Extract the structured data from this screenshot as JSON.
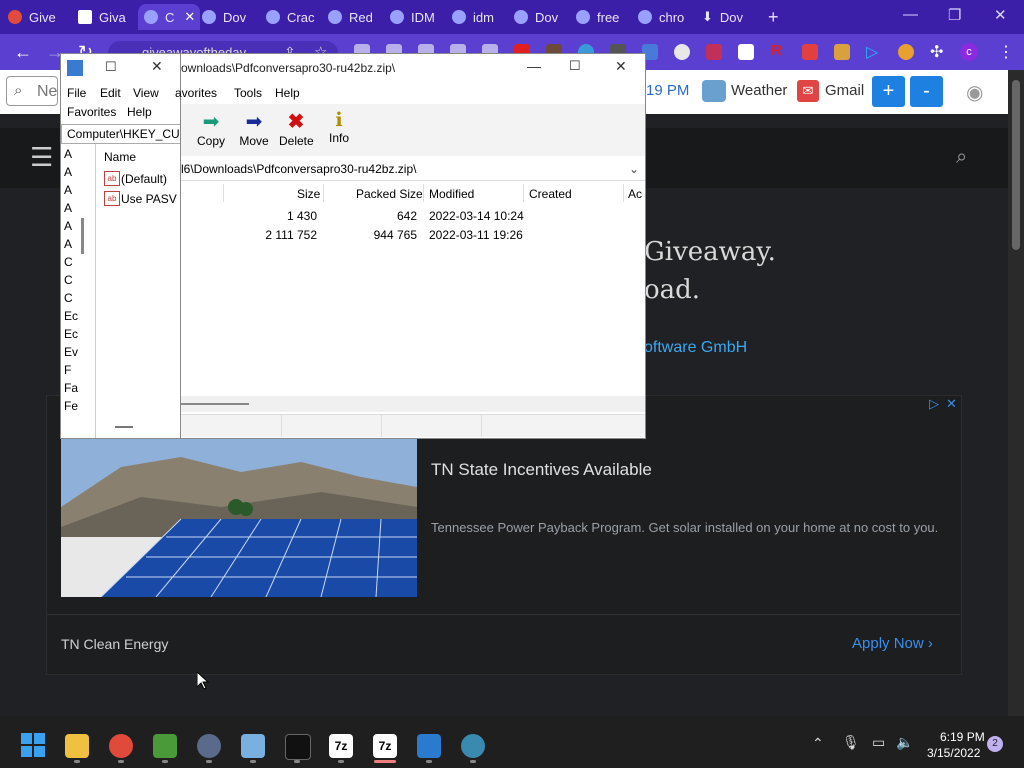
{
  "browser": {
    "tabs": [
      {
        "label": "Give",
        "color": "#e04b3c"
      },
      {
        "label": "Giva",
        "color": "#d44638"
      },
      {
        "label": "C",
        "color": "#9aa0ff"
      },
      {
        "label": "Dov",
        "color": "#9aa0ff"
      },
      {
        "label": "Crac",
        "color": "#9aa0ff"
      },
      {
        "label": "Red",
        "color": "#9aa0ff"
      },
      {
        "label": "IDM",
        "color": "#9aa0ff"
      },
      {
        "label": "idm",
        "color": "#9aa0ff"
      },
      {
        "label": "Dov",
        "color": "#9aa0ff"
      },
      {
        "label": "free",
        "color": "#9aa0ff"
      },
      {
        "label": "chro",
        "color": "#9aa0ff"
      },
      {
        "label": "Dov",
        "color": "#ffffff"
      }
    ],
    "new_tab": "+",
    "address": "giveawayoftheday",
    "avatar_letter": "c"
  },
  "bookmarks": {
    "search_placeholder": "Ne",
    "time_fragment": "19 PM",
    "weather": "Weather",
    "gmail": "Gmail",
    "zoom_in": "+",
    "zoom_out": "-"
  },
  "site": {
    "headline1": "Giveaway.",
    "headline2": "oad.",
    "vendor": "oftware GmbH"
  },
  "ad": {
    "title": "TN State Incentives Available",
    "body": "Tennessee Power Payback Program. Get solar installed on your home at no cost to you.",
    "advertiser": "TN Clean Energy",
    "cta": "Apply Now"
  },
  "regedit": {
    "menu": [
      "File",
      "Edit",
      "View",
      "Favorites",
      "Help"
    ],
    "path": "Computer\\HKEY_CUI",
    "tree_letters": [
      "A",
      "A",
      "A",
      "A",
      "A",
      "A",
      "C",
      "C",
      "C",
      "Ec",
      "Ec",
      "Ev",
      "F",
      "Fa",
      "Fe"
    ],
    "list_header": "Name",
    "values": [
      "(Default)",
      "Use PASV"
    ]
  },
  "zip": {
    "title": "ownloads\\Pdfconversapro30-ru42bz.zip\\",
    "menu": [
      "avorites",
      "Tools",
      "Help"
    ],
    "tools": [
      {
        "label": "Copy",
        "icon": "copy-arrow-icon"
      },
      {
        "label": "Move",
        "icon": "move-arrow-icon"
      },
      {
        "label": "Delete",
        "icon": "delete-x-icon"
      },
      {
        "label": "Info",
        "icon": "info-icon"
      }
    ],
    "path": "l6\\Downloads\\Pdfconversapro30-ru42bz.zip\\",
    "columns": [
      "Size",
      "Packed Size",
      "Modified",
      "Created",
      "Ac"
    ],
    "rows": [
      {
        "size": "1 430",
        "packed": "642",
        "modified": "2022-03-14 10:24"
      },
      {
        "size": "2 111 752",
        "packed": "944 765",
        "modified": "2022-03-11 19:26"
      }
    ]
  },
  "taskbar": {
    "time": "6:19 PM",
    "date": "3/15/2022",
    "notif_count": "2"
  }
}
